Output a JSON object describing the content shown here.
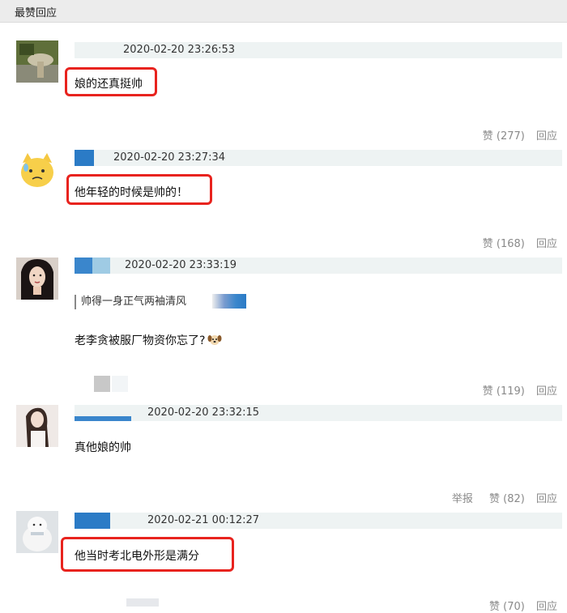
{
  "section": {
    "title": "最赞回应"
  },
  "comments": [
    {
      "timestamp": "2020-02-20 23:26:53",
      "text": "娘的还真挺帅",
      "like_label": "赞 (277)",
      "reply_label": "回应"
    },
    {
      "timestamp": "2020-02-20 23:27:34",
      "text": "他年轻的时候是帅的！",
      "like_label": "赞 (168)",
      "reply_label": "回应"
    },
    {
      "timestamp": "2020-02-20 23:33:19",
      "quote": "帅得一身正气两袖清风",
      "text": "老李贪被服厂物资你忘了?",
      "like_label": "赞 (119)",
      "reply_label": "回应"
    },
    {
      "timestamp": "2020-02-20 23:32:15",
      "text": "真他娘的帅",
      "report_label": "举报",
      "like_label": "赞 (82)",
      "reply_label": "回应"
    },
    {
      "timestamp": "2020-02-21 00:12:27",
      "text": "他当时考北电外形是满分",
      "like_label": "赞 (70)",
      "reply_label": "回应"
    }
  ],
  "colors": {
    "highlight": "#e8231e",
    "meta_bar": "#eef3f3",
    "blur_blue": "#2b7bc6"
  },
  "icons": [
    "dog-emoji-icon"
  ]
}
